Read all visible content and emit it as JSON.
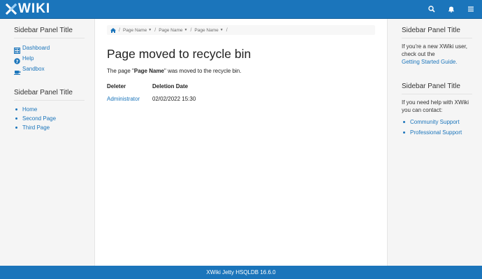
{
  "header": {
    "logo_text": "WIKI",
    "icons": [
      "search-icon",
      "bell-icon",
      "menu-icon"
    ]
  },
  "left_sidebar": {
    "panel1": {
      "title": "Sidebar Panel Title",
      "links": [
        {
          "label": "Dashboard",
          "icon": "dashboard-icon"
        },
        {
          "label": "Help",
          "icon": "help-icon"
        },
        {
          "label": "Sandbox",
          "icon": "sandbox-icon"
        }
      ]
    },
    "panel2": {
      "title": "Sidebar Panel Title",
      "items": [
        "Home",
        "Second Page",
        "Third Page"
      ]
    }
  },
  "breadcrumb": {
    "home_icon": "home-icon",
    "items": [
      "Page Name",
      "Page Name",
      "Page Name"
    ]
  },
  "main": {
    "title": "Page moved to recycle bin",
    "message_prefix": "The page \"",
    "message_page": "Page Name",
    "message_suffix": "\" was moved to the recycle bin.",
    "table": {
      "headers": [
        "Deleter",
        "Deletion Date"
      ],
      "rows": [
        {
          "deleter": "Administrator",
          "date": "02/02/2022 15:30"
        }
      ]
    }
  },
  "right_sidebar": {
    "panel1": {
      "title": "Sidebar Panel Title",
      "text": "If you're a new XWiki user, check out the",
      "link": "Getting Started Guide."
    },
    "panel2": {
      "title": "Sidebar Panel Title",
      "text": "If you need help with XWiki you can contact:",
      "links": [
        "Community Support",
        "Professional Support"
      ]
    }
  },
  "footer": {
    "text": "XWiki Jetty HSQLDB 16.6.0"
  },
  "colors": {
    "brand": "#1b75bb",
    "background": "#f5f5f5",
    "content_background": "#ffffff"
  }
}
